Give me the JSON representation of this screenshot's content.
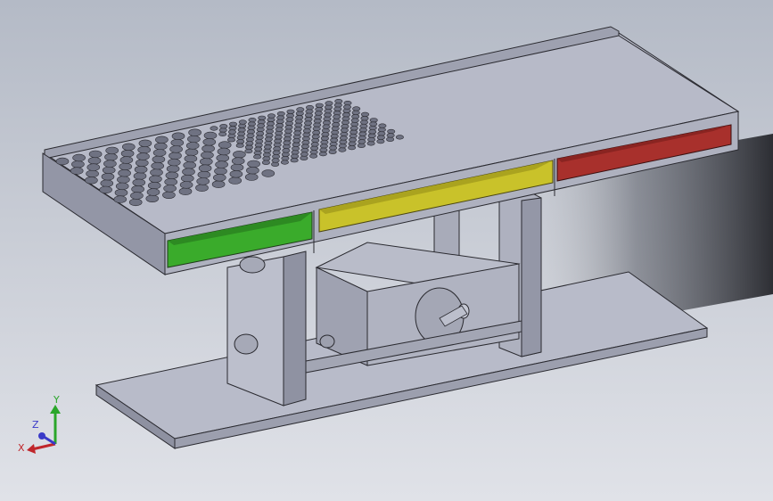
{
  "viewport": {
    "background_top": "#b4bac6",
    "background_bottom": "#e0e2e8"
  },
  "colors": {
    "body": "#b0b3c2",
    "body_light": "#c4c7d4",
    "body_dark": "#8e91a1",
    "edge": "#2a2a30",
    "bin_green": "#3aab2b",
    "bin_yellow": "#c9c22a",
    "bin_red": "#a8302c"
  },
  "model": {
    "parts": [
      "sieve-tray",
      "coarse-screen",
      "fine-screen",
      "green-bin",
      "yellow-bin",
      "red-bin",
      "support-frame",
      "motor-housing",
      "base-plate"
    ]
  },
  "triad": {
    "x_label": "X",
    "y_label": "Y",
    "z_label": "Z",
    "x_color": "#c0262b",
    "y_color": "#2aa62a",
    "z_color": "#3a3ac8"
  }
}
